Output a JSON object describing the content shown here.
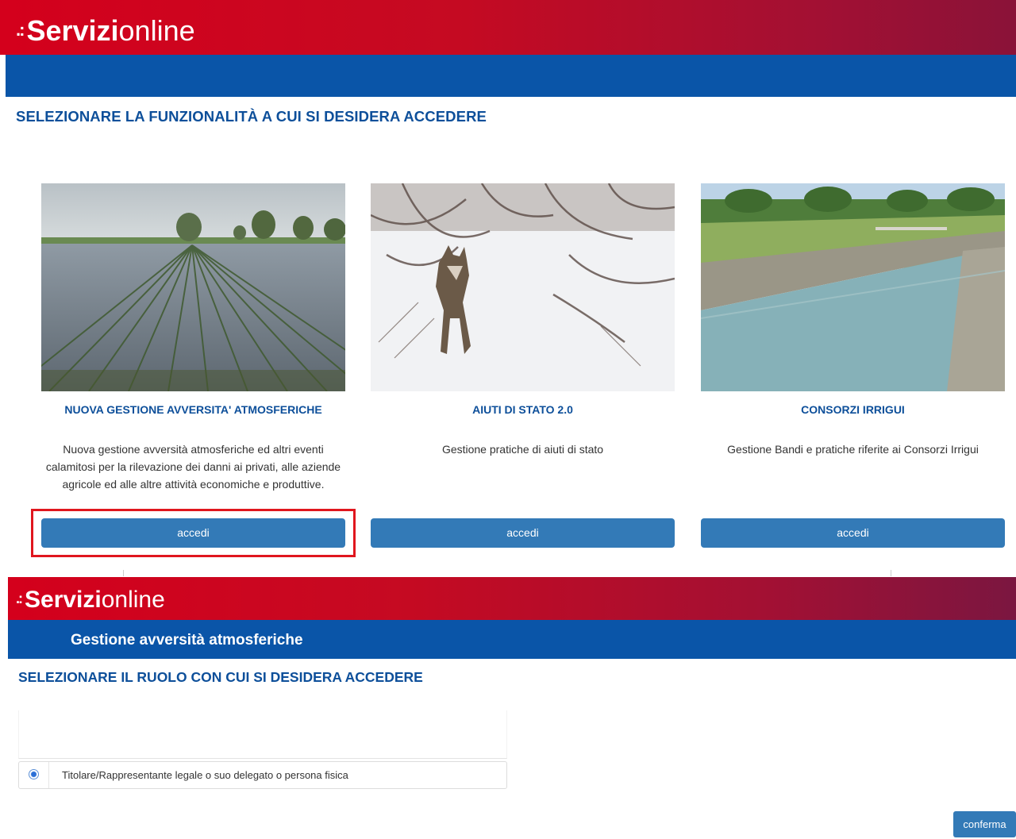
{
  "header_top": {
    "brand_strong": "Servizi",
    "brand_light": "online",
    "brand_dots": ".:"
  },
  "page1": {
    "heading": "SELEZIONARE LA FUNZIONALITÀ A CUI SI DESIDERA ACCEDERE",
    "cards": [
      {
        "title": "NUOVA GESTIONE AVVERSITA' ATMOSFERICHE",
        "description": "Nuova gestione avversità atmosferiche ed altri eventi calamitosi per la rilevazione dei danni ai privati, alle aziende agricole ed alle altre attività economiche e produttive.",
        "button": "accedi",
        "image": "flooded-field"
      },
      {
        "title": "AIUTI DI STATO 2.0",
        "description": "Gestione pratiche di aiuti di stato",
        "button": "accedi",
        "image": "wolf-in-snow"
      },
      {
        "title": "CONSORZI IRRIGUI",
        "description": "Gestione Bandi e pratiche riferite ai Consorzi Irrigui",
        "button": "accedi",
        "image": "irrigation-canal"
      }
    ]
  },
  "header_bottom": {
    "brand_strong": "Servizi",
    "brand_light": "online",
    "brand_dots": ".:",
    "app_title": "Gestione avversità atmosferiche"
  },
  "page2": {
    "heading": "SELEZIONARE IL RUOLO CON CUI SI DESIDERA ACCEDERE",
    "roles": [
      {
        "label": "Titolare/Rappresentante legale o suo delegato o persona fisica",
        "selected": true
      }
    ],
    "confirm_button": "conferma"
  },
  "colors": {
    "brand_red": "#d4001c",
    "brand_blue": "#0a55a8",
    "button_blue": "#337ab7",
    "highlight_red": "#e0161e",
    "heading_blue": "#0d4f9a"
  }
}
